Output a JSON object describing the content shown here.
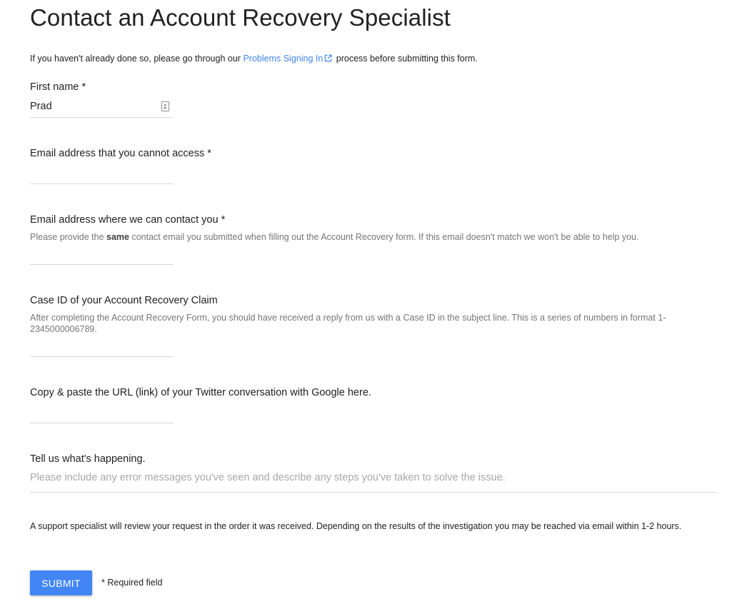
{
  "page": {
    "title": "Contact an Account Recovery Specialist"
  },
  "intro": {
    "before_link": "If you haven't already done so, please go through our ",
    "link_text": "Problems Signing In",
    "after_link": " process before submitting this form."
  },
  "fields": {
    "first_name": {
      "label": "First name *",
      "value": "Prad"
    },
    "email_cannot_access": {
      "label": "Email address that you cannot access *",
      "value": ""
    },
    "contact_email": {
      "label": "Email address where we can contact you *",
      "help_before": "Please provide the ",
      "help_bold": "same",
      "help_after": " contact email you submitted when filling out the Account Recovery form. If this email doesn't match we won't be able to help you.",
      "value": ""
    },
    "case_id": {
      "label": "Case ID of your Account Recovery Claim",
      "help": "After completing the Account Recovery Form, you should have received a reply from us with a Case ID in the subject line. This is a series of numbers in format 1-2345000006789.",
      "value": ""
    },
    "twitter_url": {
      "label": "Copy & paste the URL (link) of your Twitter conversation with Google here.",
      "value": ""
    },
    "happening": {
      "label": "Tell us what's happening.",
      "placeholder": "Please include any error messages you've seen and describe any steps you've taken to solve the issue.",
      "value": ""
    }
  },
  "notice": "A support specialist will review your request in the order it was received. Depending on the results of the investigation you may be reached via email within 1-2 hours.",
  "submit_label": "SUBMIT",
  "required_note": "* Required field",
  "icons": {
    "external_link": "external-link-icon",
    "contact_card": "contact-card-icon"
  },
  "colors": {
    "accent": "#4285f4",
    "text": "#212121",
    "help_text": "#757575",
    "placeholder": "#a8a8a8",
    "underline": "#d6d6d6"
  }
}
